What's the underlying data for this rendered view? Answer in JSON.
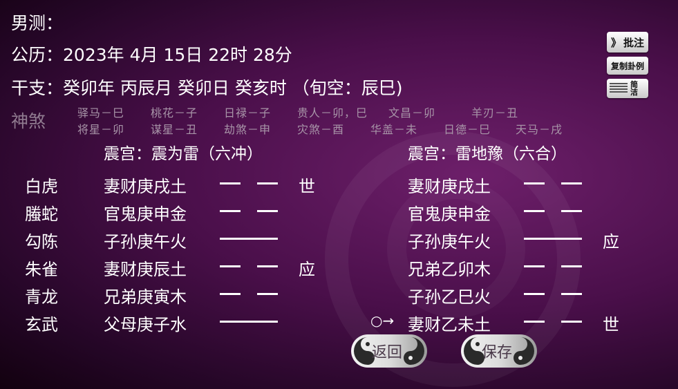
{
  "header": {
    "gender": "男测：",
    "calendar_label": "公历：",
    "calendar_value": "2023年 4月 15日 22时 28分",
    "ganzhi_label": "干支：",
    "ganzhi_value": "癸卯年 丙辰月 癸卯日 癸亥时 （旬空：辰巳)"
  },
  "shensha": {
    "label": "神煞",
    "row1": [
      "驿马－巳",
      "桃花－子",
      "日禄－子",
      "贵人－卯，巳",
      "文昌－卯",
      "羊刃－丑"
    ],
    "row2": [
      "将星－卯",
      "谋星－丑",
      "劫煞－申",
      "灾煞－酉",
      "华盖－未",
      "日德－巳",
      "天马－戌"
    ]
  },
  "main_gua": {
    "title": "震宫：震为雷（六冲）",
    "rows": [
      {
        "spirit": "白虎",
        "yao": "妻财庚戌土",
        "mark": "世"
      },
      {
        "spirit": "螣蛇",
        "yao": "官鬼庚申金",
        "mark": ""
      },
      {
        "spirit": "勾陈",
        "yao": "子孙庚午火",
        "mark": ""
      },
      {
        "spirit": "朱雀",
        "yao": "妻财庚辰土",
        "mark": "应"
      },
      {
        "spirit": "青龙",
        "yao": "兄弟庚寅木",
        "mark": ""
      },
      {
        "spirit": "玄武",
        "yao": "父母庚子水",
        "mark": ""
      }
    ]
  },
  "changed_gua": {
    "title": "震宫：雷地豫（六合）",
    "rows": [
      {
        "yao": "妻财庚戌土",
        "mark": ""
      },
      {
        "yao": "官鬼庚申金",
        "mark": ""
      },
      {
        "yao": "子孙庚午火",
        "mark": "应"
      },
      {
        "yao": "兄弟乙卯木",
        "mark": ""
      },
      {
        "yao": "子孙乙巳火",
        "mark": ""
      },
      {
        "yao": "妻财乙未土",
        "mark": "世"
      }
    ]
  },
  "moving_marker": "○→",
  "side_buttons": {
    "annotate": "批注",
    "annotate_icon": "》",
    "copy": "复制卦例",
    "simple": "简洁"
  },
  "bottom_buttons": {
    "back": "返回",
    "save": "保存"
  }
}
